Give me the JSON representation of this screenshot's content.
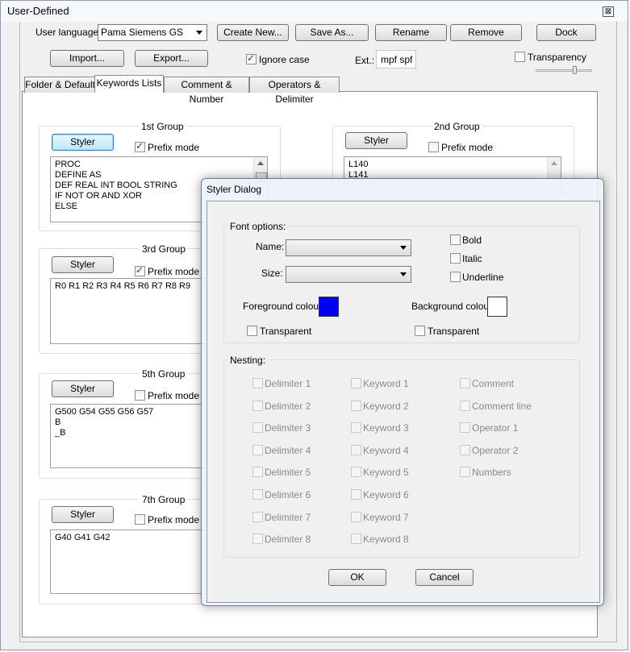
{
  "window": {
    "title": "User-Defined",
    "close_glyph": "⊠"
  },
  "toolbar": {
    "user_language_label": "User language:",
    "language_selected": "Pama Siemens GS",
    "create_new": "Create New...",
    "save_as": "Save As...",
    "rename": "Rename",
    "remove": "Remove",
    "dock": "Dock",
    "import": "Import...",
    "export": "Export...",
    "ignore_case_label": "Ignore case",
    "ignore_case_checked": true,
    "ext_label": "Ext.:",
    "ext_value": "mpf spf",
    "transparency_label": "Transparency",
    "transparency_checked": false
  },
  "tabs": [
    "Folder & Default",
    "Keywords Lists",
    "Comment & Number",
    "Operators & Delimiter"
  ],
  "active_tab": 1,
  "groups": {
    "g1": {
      "title": "1st Group",
      "styler": "Styler",
      "prefix_label": "Prefix mode",
      "prefix_checked": true,
      "lines": [
        "PROC",
        "DEFINE AS",
        "DEF REAL INT BOOL STRING",
        "IF NOT OR AND XOR",
        "ELSE"
      ]
    },
    "g2": {
      "title": "2nd Group",
      "styler": "Styler",
      "prefix_label": "Prefix mode",
      "prefix_checked": false,
      "lines": [
        "L140",
        "L141"
      ]
    },
    "g3": {
      "title": "3rd Group",
      "styler": "Styler",
      "prefix_label": "Prefix mode",
      "prefix_checked": true,
      "lines": [
        "R0 R1 R2 R3 R4 R5 R6 R7 R8 R9"
      ]
    },
    "g5": {
      "title": "5th Group",
      "styler": "Styler",
      "prefix_label": "Prefix mode",
      "prefix_checked": false,
      "lines": [
        "G500 G54 G55 G56 G57",
        "B",
        "_B"
      ]
    },
    "g7": {
      "title": "7th Group",
      "styler": "Styler",
      "prefix_label": "Prefix mode",
      "prefix_checked": false,
      "lines": [
        "G40 G41 G42"
      ]
    }
  },
  "dialog": {
    "title": "Styler Dialog",
    "font_options_label": "Font options:",
    "name_label": "Name:",
    "name_value": "",
    "size_label": "Size:",
    "size_value": "",
    "bold": "Bold",
    "italic": "Italic",
    "underline": "Underline",
    "fg_label": "Foreground colour",
    "fg_color": "#0000ff",
    "bg_label": "Background colour",
    "bg_color": "#ffffff",
    "fg_transparent": "Transparent",
    "bg_transparent": "Transparent",
    "nesting_label": "Nesting:",
    "nesting_col1": [
      "Delimiter 1",
      "Delimiter 2",
      "Delimiter 3",
      "Delimiter 4",
      "Delimiter 5",
      "Delimiter 6",
      "Delimiter 7",
      "Delimiter 8"
    ],
    "nesting_col2": [
      "Keyword 1",
      "Keyword 2",
      "Keyword 3",
      "Keyword 4",
      "Keyword 5",
      "Keyword 6",
      "Keyword 7",
      "Keyword 8"
    ],
    "nesting_col3": [
      "Comment",
      "Comment line",
      "Operator 1",
      "Operator 2",
      "Numbers"
    ],
    "ok": "OK",
    "cancel": "Cancel"
  }
}
